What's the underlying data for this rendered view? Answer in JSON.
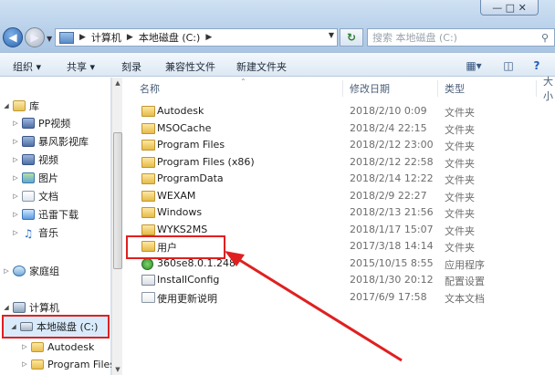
{
  "window": {
    "controls": "—  □  ✕"
  },
  "address": {
    "segments": [
      "计算机",
      "本地磁盘 (C:)"
    ],
    "search_placeholder": "搜索 本地磁盘 (C:)"
  },
  "toolbar": {
    "organize": "组织 ▾",
    "share": "共享 ▾",
    "burn": "刻录",
    "compat": "兼容性文件",
    "new_folder": "新建文件夹"
  },
  "nav": {
    "libraries": "库",
    "items": [
      {
        "label": "PP视频"
      },
      {
        "label": "暴风影视库"
      },
      {
        "label": "视频"
      },
      {
        "label": "图片"
      },
      {
        "label": "文档"
      },
      {
        "label": "迅雷下载"
      },
      {
        "label": "音乐"
      }
    ],
    "homegroup": "家庭组",
    "computer": "计算机",
    "local_disk": "本地磁盘 (C:)",
    "sub_items": [
      "Autodesk",
      "Program Files"
    ]
  },
  "columns": {
    "name": "名称",
    "date": "修改日期",
    "type": "类型",
    "size": "大小"
  },
  "files": [
    {
      "name": "Autodesk",
      "date": "2018/2/10 0:09",
      "type": "文件夹",
      "icon": "folder"
    },
    {
      "name": "MSOCache",
      "date": "2018/2/4 22:15",
      "type": "文件夹",
      "icon": "folder"
    },
    {
      "name": "Program Files",
      "date": "2018/2/12 23:00",
      "type": "文件夹",
      "icon": "folder"
    },
    {
      "name": "Program Files (x86)",
      "date": "2018/2/12 22:58",
      "type": "文件夹",
      "icon": "folder"
    },
    {
      "name": "ProgramData",
      "date": "2018/2/14 12:22",
      "type": "文件夹",
      "icon": "folder"
    },
    {
      "name": "WEXAM",
      "date": "2018/2/9 22:27",
      "type": "文件夹",
      "icon": "folder"
    },
    {
      "name": "Windows",
      "date": "2018/2/13 21:56",
      "type": "文件夹",
      "icon": "folder"
    },
    {
      "name": "WYKS2MS",
      "date": "2018/1/17 15:07",
      "type": "文件夹",
      "icon": "folder"
    },
    {
      "name": "用户",
      "date": "2017/3/18 14:14",
      "type": "文件夹",
      "icon": "folder"
    },
    {
      "name": "360se8.0.1.248",
      "date": "2015/10/15 8:55",
      "type": "应用程序",
      "icon": "app"
    },
    {
      "name": "InstallConfig",
      "date": "2018/1/30 20:12",
      "type": "配置设置",
      "icon": "cfg"
    },
    {
      "name": "使用更新说明",
      "date": "2017/6/9 17:58",
      "type": "文本文档",
      "icon": "txt"
    }
  ],
  "colors": {
    "highlight": "#e02020",
    "accent": "#2a64b0"
  }
}
